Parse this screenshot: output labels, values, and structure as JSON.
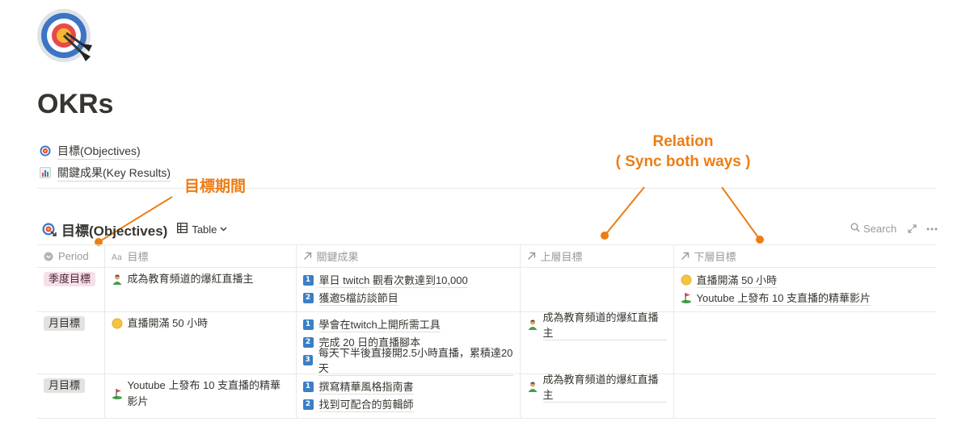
{
  "page": {
    "title": "OKRs",
    "icon": "target-dartboard-icon",
    "links": [
      {
        "icon": "target-icon",
        "label": "目標(Objectives)"
      },
      {
        "icon": "bar-chart-icon",
        "label": "關鍵成果(Key Results)"
      }
    ]
  },
  "annotations": {
    "period": "目標期間",
    "relation_line1": "Relation",
    "relation_line2": "( Sync both ways )"
  },
  "database": {
    "title": "目標(Objectives)",
    "view_label": "Table",
    "search_label": "Search",
    "columns": [
      {
        "icon": "select-icon",
        "label": "Period"
      },
      {
        "icon": "text-aa-icon",
        "label": "目標"
      },
      {
        "icon": "relation-arrow-icon",
        "label": "關鍵成果"
      },
      {
        "icon": "relation-arrow-icon",
        "label": "上層目標"
      },
      {
        "icon": "relation-arrow-icon",
        "label": "下層目標"
      }
    ],
    "rows": [
      {
        "period": "季度目標",
        "period_color": "#f5e0e9",
        "title_icon": "streamer-person-icon",
        "title": "成為教育頻道的爆紅直播主",
        "key_results": [
          {
            "n": "1",
            "text": "單日 twitch 觀看次數達到10,000"
          },
          {
            "n": "2",
            "text": "獲邀5檔訪談節目"
          }
        ],
        "parent": [],
        "children": [
          {
            "icon": "yellow-circle-icon",
            "text": "直播開滿 50 小時"
          },
          {
            "icon": "golf-flag-icon",
            "text": "Youtube 上發布 10 支直播的精華影片"
          }
        ]
      },
      {
        "period": "月目標",
        "period_color": "#e3e2e0",
        "title_icon": "yellow-circle-icon",
        "title": "直播開滿 50 小時",
        "key_results": [
          {
            "n": "1",
            "text": "學會在twitch上開所需工具"
          },
          {
            "n": "2",
            "text": "完成 20 日的直播腳本"
          },
          {
            "n": "3",
            "text": "每天下半後直接開2.5小時直播，累積達20天"
          }
        ],
        "parent": [
          {
            "icon": "streamer-person-icon",
            "text": "成為教育頻道的爆紅直播主"
          }
        ],
        "children": []
      },
      {
        "period": "月目標",
        "period_color": "#e3e2e0",
        "title_icon": "golf-flag-icon",
        "title": "Youtube 上發布 10 支直播的精華影片",
        "key_results": [
          {
            "n": "1",
            "text": "撰寫精華風格指南書"
          },
          {
            "n": "2",
            "text": "找到可配合的剪輯師"
          }
        ],
        "parent": [
          {
            "icon": "streamer-person-icon",
            "text": "成為教育頻道的爆紅直播主"
          }
        ],
        "children": []
      }
    ]
  },
  "colors": {
    "annotation": "#ed7d14",
    "number_badge": "#3b7fc4"
  }
}
